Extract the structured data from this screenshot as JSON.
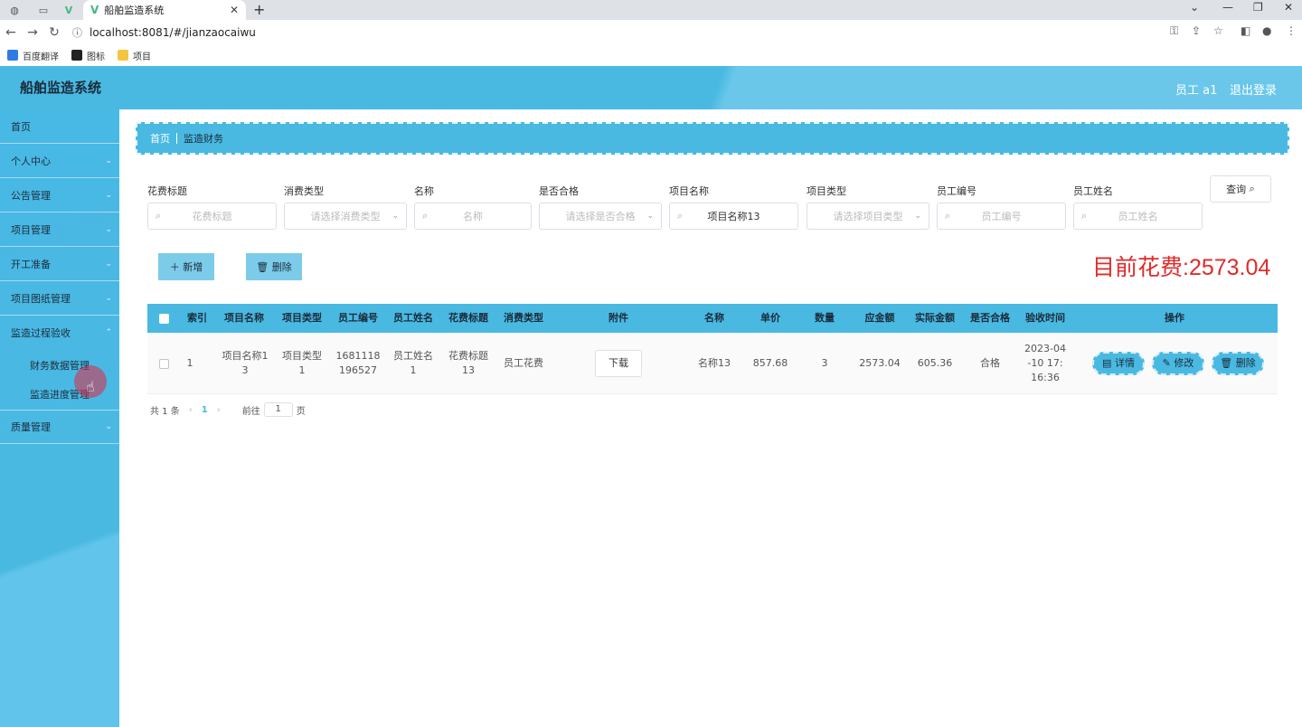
{
  "browser": {
    "tab_title": "船舶监造系统",
    "url": "localhost:8081/#/jianzaocaiwu",
    "bookmarks": [
      "百度翻译",
      "图标",
      "项目"
    ]
  },
  "app": {
    "title": "船舶监造系统",
    "user_name": "员工 a1",
    "logout": "退出登录"
  },
  "sidebar": {
    "items": [
      {
        "label": "首页"
      },
      {
        "label": "个人中心"
      },
      {
        "label": "公告管理"
      },
      {
        "label": "项目管理"
      },
      {
        "label": "开工准备"
      },
      {
        "label": "项目图纸管理"
      },
      {
        "label": "监造过程验收"
      }
    ],
    "sub_items": [
      "财务数据管理",
      "监造进度管理"
    ],
    "last_item": "质量管理"
  },
  "breadcrumb": {
    "home": "首页",
    "current": "监造财务"
  },
  "filters": [
    {
      "label": "花费标题",
      "placeholder": "花费标题",
      "value": ""
    },
    {
      "label": "消费类型",
      "placeholder": "请选择消费类型",
      "value": ""
    },
    {
      "label": "名称",
      "placeholder": "名称",
      "value": ""
    },
    {
      "label": "是否合格",
      "placeholder": "请选择是否合格",
      "value": ""
    },
    {
      "label": "项目名称",
      "placeholder": "",
      "value": "项目名称13"
    },
    {
      "label": "项目类型",
      "placeholder": "请选择项目类型",
      "value": ""
    },
    {
      "label": "员工编号",
      "placeholder": "员工编号",
      "value": ""
    },
    {
      "label": "员工姓名",
      "placeholder": "员工姓名",
      "value": ""
    }
  ],
  "query_button": "查询",
  "actions": {
    "add": "新增",
    "delete": "删除"
  },
  "total_cost": "目前花费:2573.04",
  "table": {
    "headers": [
      "索引",
      "项目名称",
      "项目类型",
      "员工编号",
      "员工姓名",
      "花费标题",
      "消费类型",
      "附件",
      "名称",
      "单价",
      "数量",
      "应金额",
      "实际金额",
      "是否合格",
      "验收时间",
      "操作"
    ],
    "rows": [
      {
        "index": "1",
        "project_name": "项目名称13",
        "project_type": "项目类型1",
        "employee_no": "1681118196527",
        "employee_name": "员工姓名1",
        "cost_title": "花费标题13",
        "consume_type": "员工花费",
        "attachment": "下载",
        "name": "名称13",
        "unit_price": "857.68",
        "quantity": "3",
        "due_amount": "2573.04",
        "actual_amount": "605.36",
        "qualified": "合格",
        "check_time": "2023-04-10 17:16:36",
        "ops": [
          "详情",
          "修改",
          "删除"
        ]
      }
    ]
  },
  "pagination": {
    "total": "共 1 条",
    "current": "1",
    "goto": "前往",
    "page_input": "1",
    "page_suffix": "页"
  }
}
